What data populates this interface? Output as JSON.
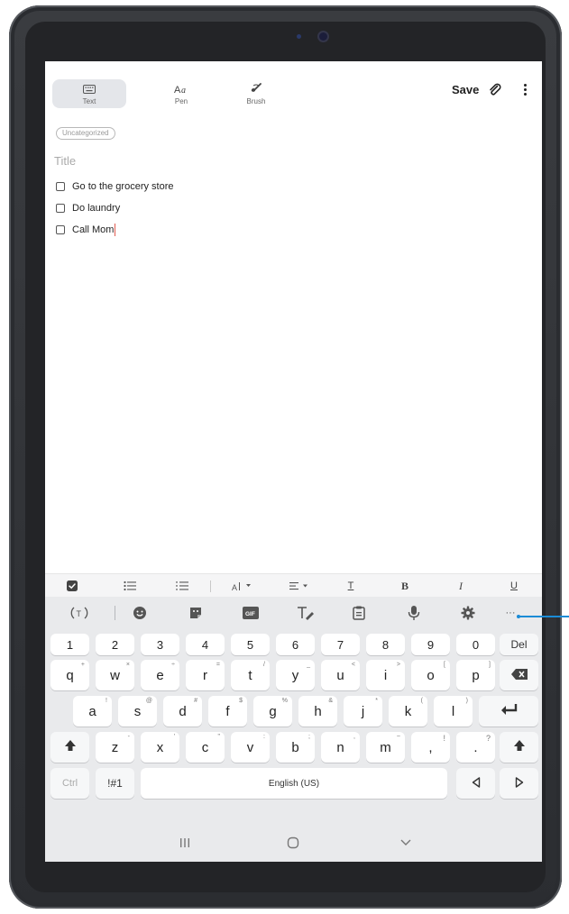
{
  "notes": {
    "modes": [
      {
        "label": "Text",
        "icon": "keyboard-icon"
      },
      {
        "label": "Pen",
        "icon": "pen-text-icon"
      },
      {
        "label": "Brush",
        "icon": "brush-icon"
      }
    ],
    "save_label": "Save",
    "category": "Uncategorized",
    "title_placeholder": "Title",
    "todos": [
      "Go to the grocery store",
      "Do laundry",
      "Call Mom"
    ]
  },
  "format_bar": {
    "icons": [
      "checkbox-icon",
      "bulleted-list-icon",
      "numbered-list-icon",
      "font-size-icon",
      "align-icon",
      "text-color-icon",
      "bold-icon",
      "italic-icon",
      "underline-icon"
    ],
    "bold": "B",
    "italic": "I",
    "underline": "U",
    "text_color": "T"
  },
  "keyboard": {
    "toolbar_icons": [
      "translate-icon",
      "emoji-icon",
      "sticker-icon",
      "gif-icon",
      "handwriting-icon",
      "clipboard-icon",
      "microphone-icon",
      "settings-icon",
      "more-icon"
    ],
    "gif_label": "GIF",
    "more_label": "···",
    "number_row": [
      "1",
      "2",
      "3",
      "4",
      "5",
      "6",
      "7",
      "8",
      "9",
      "0"
    ],
    "del_label": "Del",
    "row1": [
      {
        "k": "q",
        "h": "+"
      },
      {
        "k": "w",
        "h": "×"
      },
      {
        "k": "e",
        "h": "÷"
      },
      {
        "k": "r",
        "h": "="
      },
      {
        "k": "t",
        "h": "/"
      },
      {
        "k": "y",
        "h": "_"
      },
      {
        "k": "u",
        "h": "<"
      },
      {
        "k": "i",
        "h": ">"
      },
      {
        "k": "o",
        "h": "["
      },
      {
        "k": "p",
        "h": "]"
      }
    ],
    "row2": [
      {
        "k": "a",
        "h": "!"
      },
      {
        "k": "s",
        "h": "@"
      },
      {
        "k": "d",
        "h": "#"
      },
      {
        "k": "f",
        "h": "$"
      },
      {
        "k": "g",
        "h": "%"
      },
      {
        "k": "h",
        "h": "&"
      },
      {
        "k": "j",
        "h": "*"
      },
      {
        "k": "k",
        "h": "("
      },
      {
        "k": "l",
        "h": ")"
      }
    ],
    "row3": [
      {
        "k": "z",
        "h": "-"
      },
      {
        "k": "x",
        "h": "'"
      },
      {
        "k": "c",
        "h": "\""
      },
      {
        "k": "v",
        "h": ":"
      },
      {
        "k": "b",
        "h": ";"
      },
      {
        "k": "n",
        "h": ","
      },
      {
        "k": "m",
        "h": "~"
      }
    ],
    "comma_key": ",",
    "comma_hint": "!",
    "period_key": ".",
    "period_hint": "?",
    "ctrl_label": "Ctrl",
    "symbols_label": "!#1",
    "space_label": "English (US)",
    "icons": [
      "backspace-icon",
      "enter-icon",
      "shift-icon",
      "left-arrow-icon",
      "right-arrow-icon"
    ]
  },
  "navbar": {
    "icons": [
      "recents-icon",
      "home-icon",
      "hide-keyboard-icon"
    ]
  },
  "colors": {
    "accent": "#1a8bd6",
    "caret": "#e05a4f",
    "keyboard_bg": "#e9eaec"
  }
}
